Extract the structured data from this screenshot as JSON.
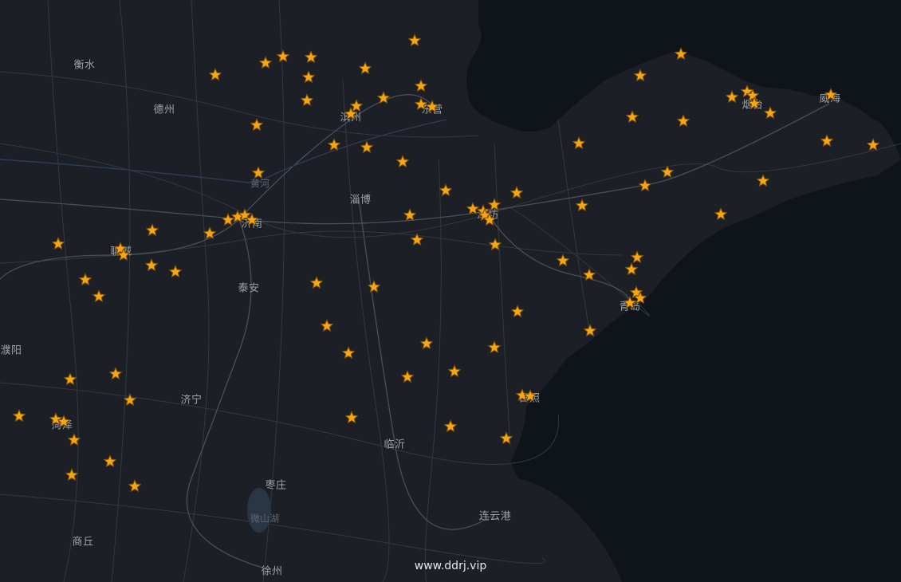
{
  "map": {
    "colors": {
      "land": "#1c1f26",
      "sea": "#0f141b",
      "road": "#34383f",
      "highway": "#474c55",
      "label": "#9ea3ad",
      "marker_fill": "#f3a712",
      "marker_stroke": "#7a4a00"
    },
    "city_labels": [
      "衡水",
      "德州",
      "滨州",
      "东营",
      "黄河",
      "济南",
      "淄博",
      "潍坊",
      "烟台",
      "威海",
      "聊城",
      "泰安",
      "濮阳",
      "济宁",
      "菏泽",
      "日照",
      "临沂",
      "枣庄",
      "微山湖",
      "连云港",
      "商丘",
      "徐州",
      "青岛"
    ],
    "marker_icon": "star-marker-icon",
    "marker_count": 92
  },
  "watermark": "www.ddrj.vip"
}
